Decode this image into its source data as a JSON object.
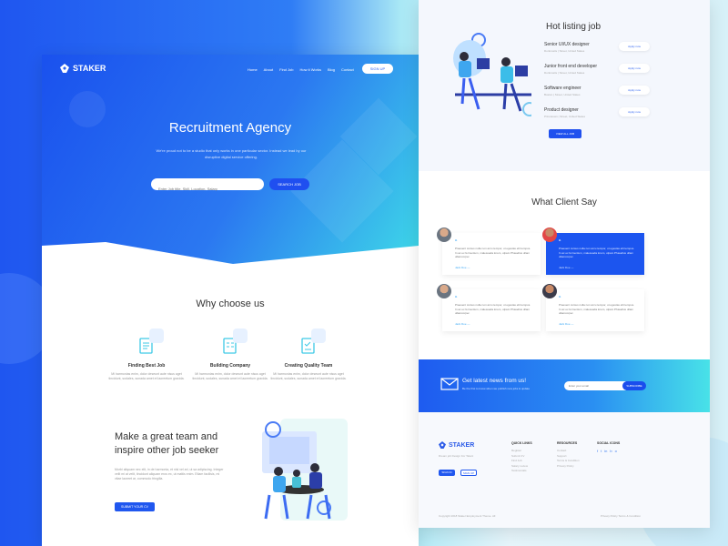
{
  "brand": "STAKER",
  "nav": {
    "links": [
      "Home",
      "About",
      "Find Job",
      "How it Works",
      "Blog",
      "Contact"
    ],
    "signup_label": "SIGN UP"
  },
  "hero": {
    "title": "Recruitment Agency",
    "subtitle": "We're proud not to be a studio that only works in one particular sector. Instead we lead by our disruptive digital service offering.",
    "search_placeholder": "Enter Job title, Skill, Location, Salary",
    "search_button": "SEARCH JOB"
  },
  "why": {
    "title": "Why choose us",
    "features": [
      {
        "title": "Finding Best Job",
        "text": "Mi harmonias enim, dolor deseunt aute nisus aget tincidunt, sodales, sunada amet et laoreetum gravida."
      },
      {
        "title": "Building Company",
        "text": "Mi harmonias enim, dolor deseunt aute nisus aget tincidunt, sodales, sunada amet et laoreetum gravida."
      },
      {
        "title": "Creating Quality Team",
        "text": "Mi harmonias enim, dolor deseunt aute nisus aget tincidunt, sodales, sunada amet et laoreetum gravida."
      }
    ]
  },
  "team": {
    "title": "Make a great team and inspire other job seeker",
    "text": "Morbi aliquam nec elit, in de harmonia, et nisl vel ari, ut sa adipiscing. Integer velit mi at velit, tincidunt aliquam eros ex, ut mattis enim. Etiam facilisis, mi vitae laoreet ar, commodo fringilla.",
    "button": "SUBMIT YOUR CV"
  },
  "hot": {
    "title": "Hot listing job",
    "jobs": [
      {
        "title": "Senior UI/UX designer",
        "meta": "Dunkrustis  |  Street, United States",
        "apply": "Apply now"
      },
      {
        "title": "Junior front end developer",
        "meta": "Dunkrustis  |  Street, United States",
        "apply": "Apply now"
      },
      {
        "title": "Software engineer",
        "meta": "Boston  |  Street, United States",
        "apply": "Apply now"
      },
      {
        "title": "Product designer",
        "meta": "Princetown  |  Street, United States",
        "apply": "Apply now"
      }
    ],
    "view_all": "VIEW ALL JOB"
  },
  "clients": {
    "title": "What Client Say",
    "items": [
      {
        "quote": "“",
        "text": "Praesent cursus nulla non arcu tempor, ut egestas elit tempus. In ac ex fermentum, malesuada lorem, ulpam Phasellus ullam ullamcorper.",
        "author": "Jack Doe  —"
      },
      {
        "quote": "“",
        "text": "Praesent cursus nulla non arcu tempor, ut egestas elit tempus. In ac ex fermentum, malesuada lorem, ulpam Phasellus ullam ullamcorper.",
        "author": "Jack Doe  —"
      },
      {
        "quote": "“",
        "text": "Praesent cursus nulla non arcu tempor, ut egestas elit tempus. In ac ex fermentum, malesuada lorem, ulpam Phasellus ullam ullamcorper.",
        "author": "Jack Doe  —"
      },
      {
        "quote": "“",
        "text": "Praesent cursus nulla non arcu tempor, ut egestas elit tempus. In ac ex fermentum, malesuada lorem, ulpam Phasellus ullam ullamcorper.",
        "author": "Jack Doe  —"
      }
    ]
  },
  "newsletter": {
    "title": "Get latest news from us!",
    "subtitle": "Be the first to know when we publish new jobs & update",
    "placeholder": "Enter your email",
    "button": "SUBSCRIBE"
  },
  "footer": {
    "desc": "Dream job Design For Talent",
    "btn_signin": "SIGN IN",
    "btn_signup": "SIGN UP",
    "quick_title": "QUICK LINKS",
    "quick_links": [
      "Register",
      "Submit CV",
      "Find Job",
      "Salary review",
      "Testimonials"
    ],
    "res_title": "RESOURCES",
    "res_links": [
      "Contact",
      "Support",
      "Terms & Condition",
      "Privacy Policy"
    ],
    "social_title": "SOCIAL ICONS",
    "copyright": "Copyright 2018 Staker Employment Theme. All",
    "policy": "Privacy Policy  Terms & Condition"
  },
  "colors": {
    "primary": "#1f56f0",
    "accent": "#3ed9e8"
  }
}
